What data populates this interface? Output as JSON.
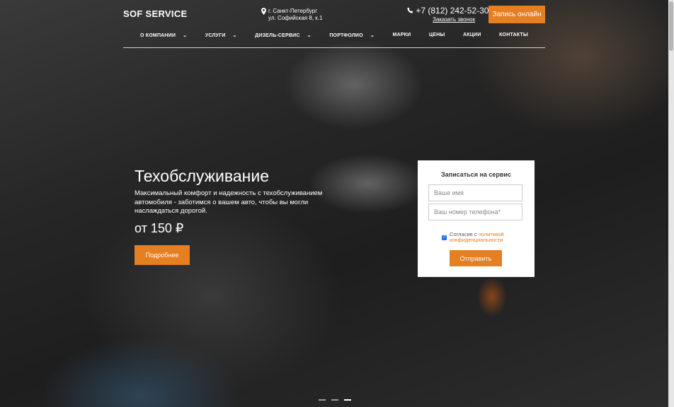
{
  "header": {
    "logo": "SOF SERVICE",
    "address": {
      "city": "г. Санкт-Петербург",
      "street": "ул. Софийская 8, к.1"
    },
    "phone": "+7 (812) 242-52-30",
    "callback_link": "Заказать звонок",
    "online_button": "Запись онлайн"
  },
  "nav": {
    "items": [
      {
        "label": "О КОМПАНИИ",
        "dropdown": true
      },
      {
        "label": "УСЛУГИ",
        "dropdown": true
      },
      {
        "label": "ДИЗЕЛЬ-СЕРВИС",
        "dropdown": true
      },
      {
        "label": "ПОРТФОЛИО",
        "dropdown": true
      },
      {
        "label": "МАРКИ",
        "dropdown": false
      },
      {
        "label": "ЦЕНЫ",
        "dropdown": false
      },
      {
        "label": "АКЦИИ",
        "dropdown": false
      },
      {
        "label": "КОНТАКТЫ",
        "dropdown": false
      }
    ]
  },
  "hero": {
    "title": "Техобслуживание",
    "description": "Максимальный комфорт и надежность с техобслуживанием автомобиля - заботимся о вашем авто, чтобы вы могли наслаждаться дорогой.",
    "price": "от 150 ₽",
    "more_button": "Подробнее"
  },
  "form": {
    "title": "Записаться на сервис",
    "name_placeholder": "Ваше имя",
    "phone_placeholder": "Ваш номер телефона*",
    "agree_text": "Согласие с ",
    "agree_link": "политикой конфиденциальности",
    "agree_checked": true,
    "submit": "Отправить"
  },
  "slider": {
    "count": 3,
    "active": 2
  },
  "colors": {
    "accent": "#e67e22",
    "form_bg": "#ffffff"
  },
  "icons": {
    "address": "map-pin-icon",
    "phone": "phone-icon",
    "dropdown": "chevron-down-icon"
  }
}
